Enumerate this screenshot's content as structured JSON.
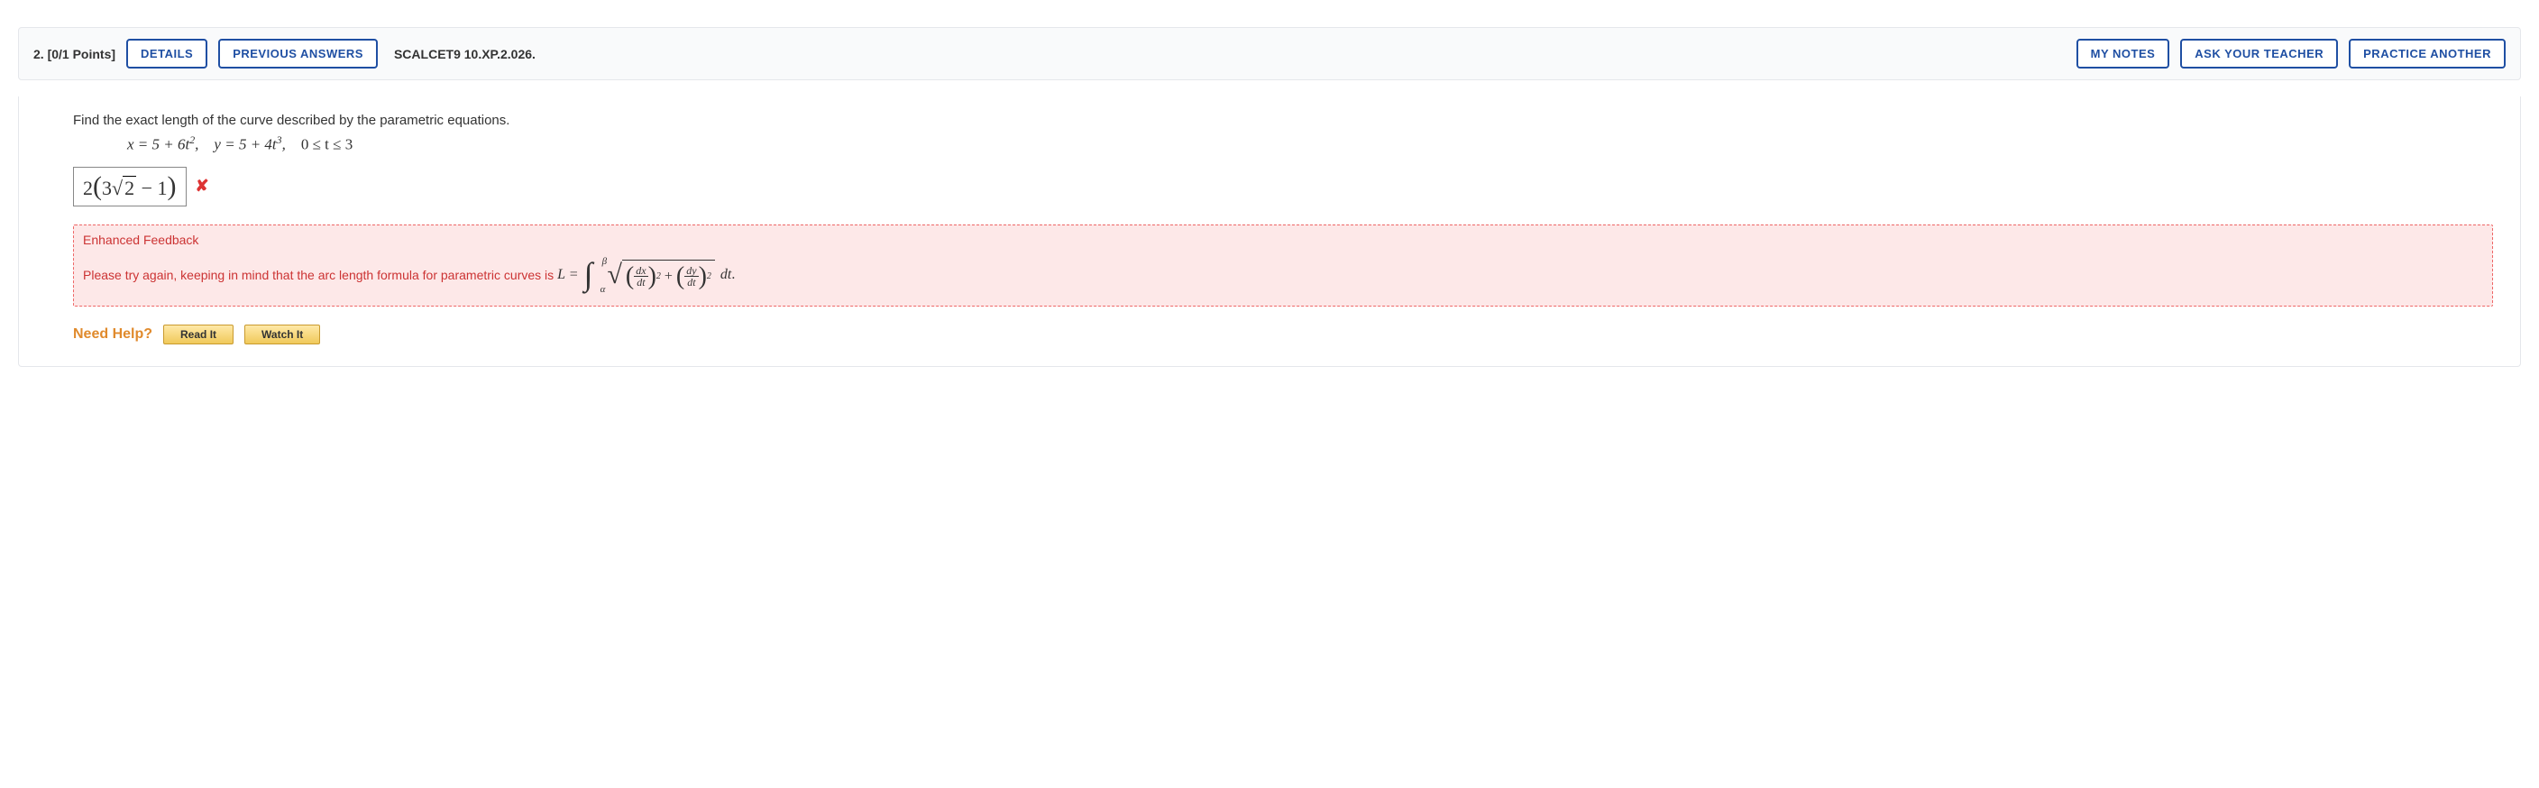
{
  "header": {
    "question_number": "2.",
    "points": "[0/1 Points]",
    "details_label": "DETAILS",
    "previous_label": "PREVIOUS ANSWERS",
    "source": "SCALCET9 10.XP.2.026.",
    "my_notes_label": "MY NOTES",
    "ask_teacher_label": "ASK YOUR TEACHER",
    "practice_another_label": "PRACTICE ANOTHER"
  },
  "question": {
    "prompt": "Find the exact length of the curve described by the parametric equations.",
    "eq_x": "x = 5 + 6t",
    "eq_x_exp": "2",
    "eq_y": "y = 5 + 4t",
    "eq_y_exp": "3",
    "domain": "0 ≤ t ≤ 3"
  },
  "answer": {
    "submitted_display": "2(3√2 − 1)",
    "correct": false
  },
  "feedback": {
    "title": "Enhanced Feedback",
    "text_before": "Please try again, keeping in mind that the arc length formula for parametric curves is ",
    "formula_lhs": "L =",
    "int_lower": "α",
    "int_upper": "β",
    "frac1_num": "dx",
    "frac1_den": "dt",
    "plus": "+",
    "frac2_num": "dy",
    "frac2_den": "dt",
    "dt": "dt",
    "period": "."
  },
  "help": {
    "need_help": "Need Help?",
    "read_it": "Read It",
    "watch_it": "Watch It"
  }
}
